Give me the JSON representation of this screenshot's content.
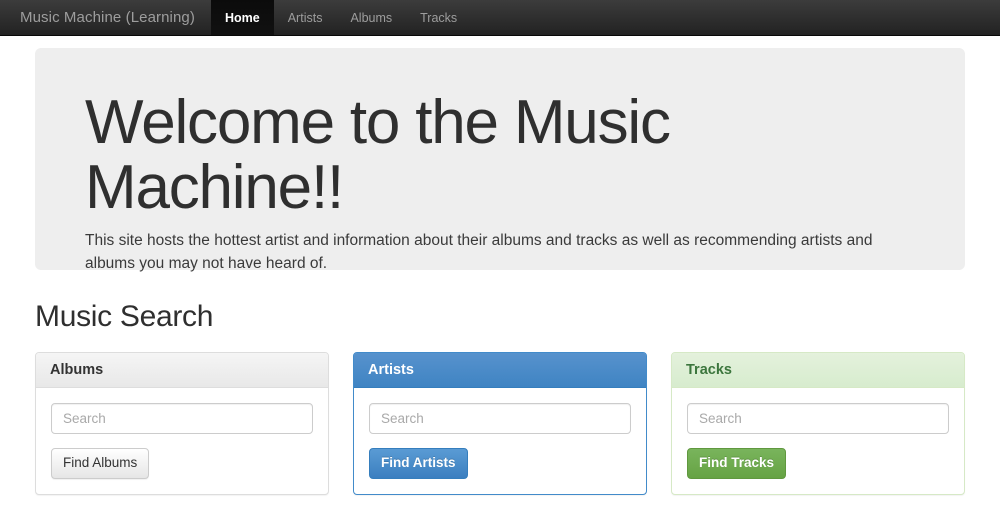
{
  "navbar": {
    "brand": "Music Machine (Learning)",
    "items": [
      {
        "label": "Home",
        "active": true
      },
      {
        "label": "Artists",
        "active": false
      },
      {
        "label": "Albums",
        "active": false
      },
      {
        "label": "Tracks",
        "active": false
      }
    ]
  },
  "jumbotron": {
    "heading": "Welcome to the Music Machine!!",
    "paragraph": "This site hosts the hottest artist and information about their albums and tracks as well as recommending artists and albums you may not have heard of."
  },
  "main": {
    "section_heading": "Music Search",
    "panels": [
      {
        "title": "Albums",
        "style": "default",
        "search_placeholder": "Search",
        "search_value": "",
        "button_label": "Find Albums",
        "header_bg": "#f5f5f5",
        "header_text_color": "#333333"
      },
      {
        "title": "Artists",
        "style": "primary",
        "search_placeholder": "Search",
        "search_value": "",
        "button_label": "Find Artists",
        "header_bg": "#428bca",
        "header_text_color": "#ffffff"
      },
      {
        "title": "Tracks",
        "style": "success",
        "search_placeholder": "Search",
        "search_value": "",
        "button_label": "Find Tracks",
        "header_bg": "#dff0d8",
        "header_text_color": "#3c763d"
      }
    ]
  }
}
